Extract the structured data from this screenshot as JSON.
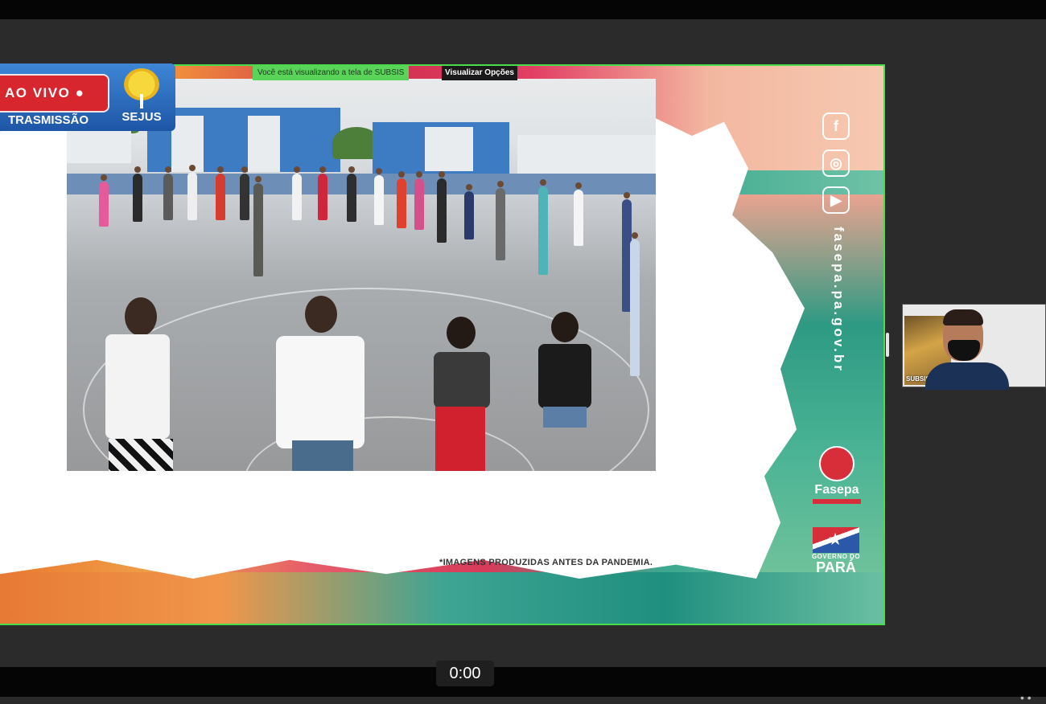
{
  "live_badge": {
    "live_label": "AO VIVO ●",
    "broadcast_label": "TRASMISSÃO",
    "org_name": "SEJUS"
  },
  "share_banner": {
    "viewing_text": "Você está visualizando a tela de SUBSIS",
    "view_options_label": "Visualizar Opções"
  },
  "slide": {
    "disclaimer": "*IMAGENS PRODUZIDAS ANTES DA PANDEMIA.",
    "website_vertical": "fasepa.pa.gov.br",
    "social_icons": [
      "facebook-icon",
      "instagram-icon",
      "youtube-icon"
    ],
    "logo_fasepa": "Fasepa",
    "logo_para": "PARÁ",
    "logo_para_top": "GOVERNO DO"
  },
  "participant_thumbnail": {
    "name": "SUBSIS"
  },
  "player": {
    "time": "0:00"
  },
  "colors": {
    "live_red": "#d8262f",
    "broadcast_blue": "#2a66b8",
    "share_border": "#4bdc4b",
    "banner_green": "#5ad35a"
  }
}
